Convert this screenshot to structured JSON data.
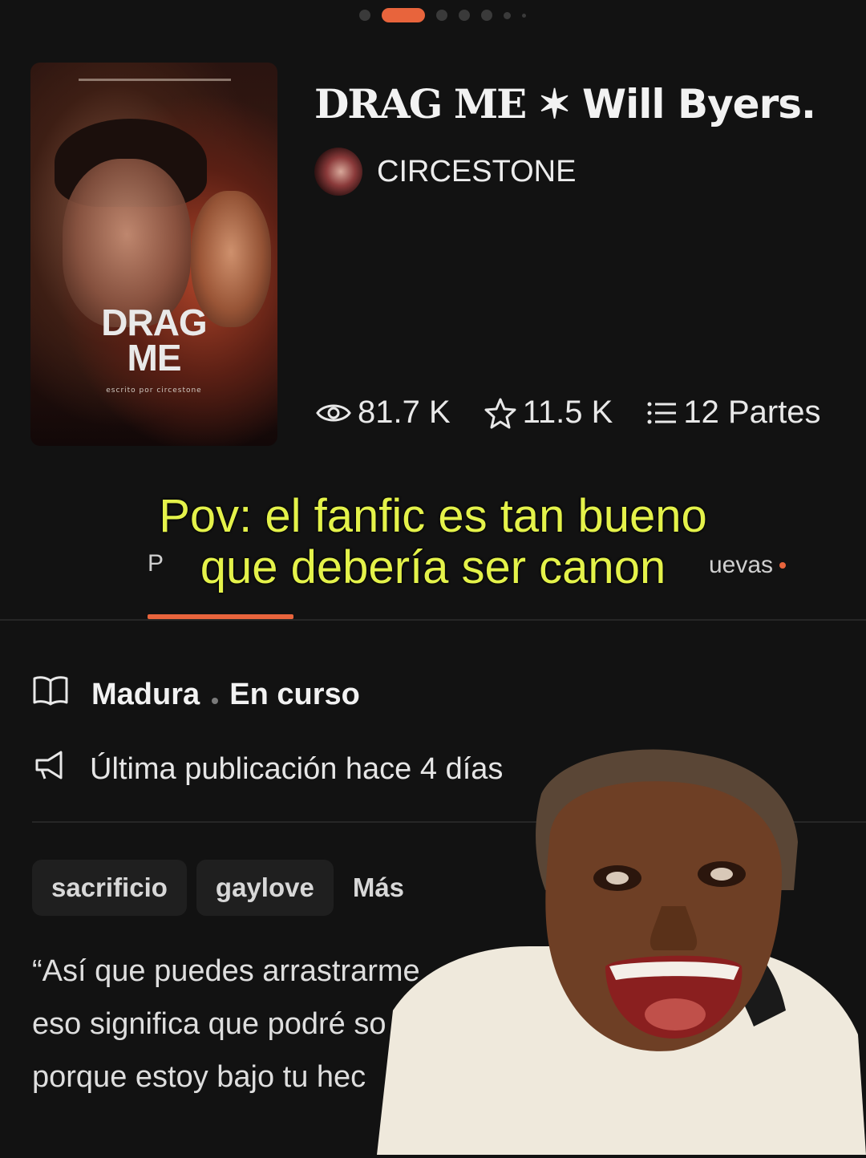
{
  "carousel": {
    "total_dots": 7,
    "active_index": 1
  },
  "story": {
    "cover": {
      "title_line1": "DRAG",
      "title_line2": "ME",
      "subtitle": "escrito por circestone"
    },
    "title_part1": "DRAG ME ✶ ",
    "title_part2": "Will Byers.",
    "author": "CIRCESTONE",
    "stats": {
      "reads": "81.7 K",
      "votes": "11.5 K",
      "parts": "12 Partes"
    }
  },
  "caption": {
    "line1": "Pov: el fanfic es tan bueno",
    "line2": "que debería ser canon"
  },
  "tabs": {
    "tab1_partial": "P",
    "tab2_partial": "uevas"
  },
  "details": {
    "rating": "Madura",
    "status": "En curso",
    "last_update": "Última publicación hace 4 días"
  },
  "tags": [
    "sacrificio",
    "gaylove"
  ],
  "more_tags_label": "Más",
  "description": {
    "line1": "“Así que puedes arrastrarme",
    "line2": "eso significa que podré so",
    "line3": "porque estoy bajo tu hec"
  },
  "colors": {
    "accent": "#e8643c",
    "caption": "#e4f24a",
    "background": "#121212"
  }
}
